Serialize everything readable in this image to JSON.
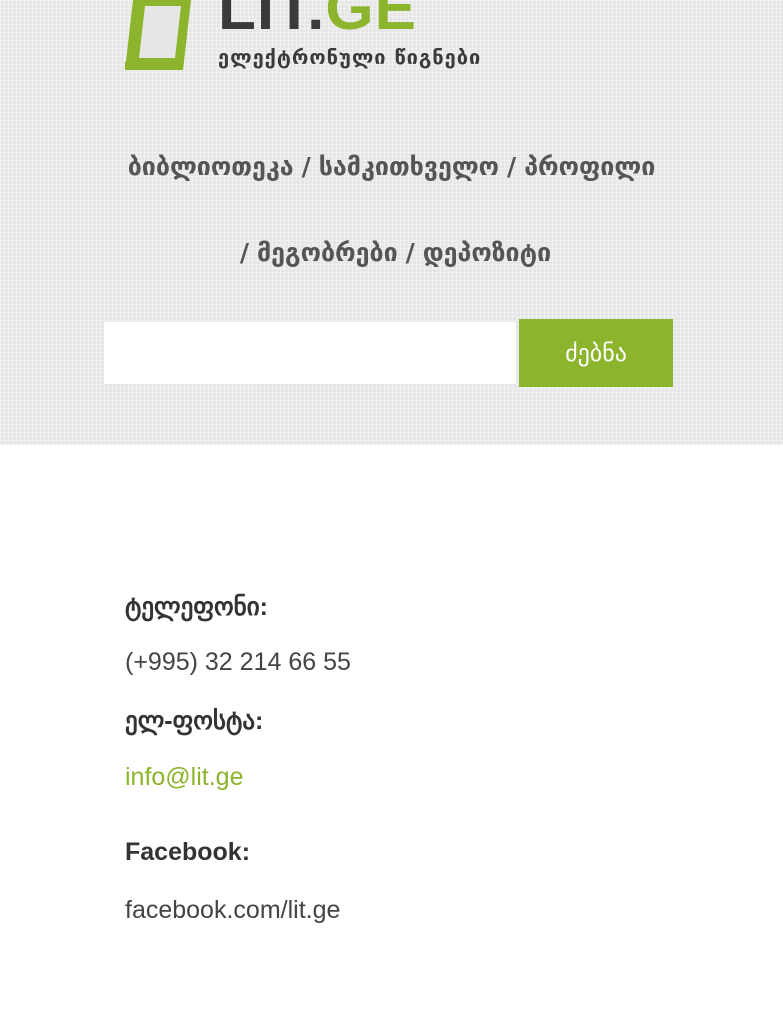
{
  "logo": {
    "part1": "LIT",
    "dot": ".",
    "part2": "GE",
    "subtitle": "ელექტრონული წიგნები"
  },
  "nav": {
    "items": [
      "ბიბლიოთეკა",
      "სამკითხველო",
      "პროფილი",
      "მეგობრები",
      "დეპოზიტი"
    ],
    "separator": "/"
  },
  "search": {
    "value": "",
    "placeholder": "",
    "button_label": "ძებნა"
  },
  "contact": {
    "phone_label": "ტელეფონი:",
    "phone_value": "(+995) 32 214 66 55",
    "email_label": "ელ-ფოსტა:",
    "email_value": "info@lit.ge",
    "facebook_label": "Facebook:",
    "facebook_value": "facebook.com/lit.ge"
  },
  "colors": {
    "accent": "#8cb42c",
    "text_dark": "#333333",
    "header_bg": "#e6e6e6"
  }
}
